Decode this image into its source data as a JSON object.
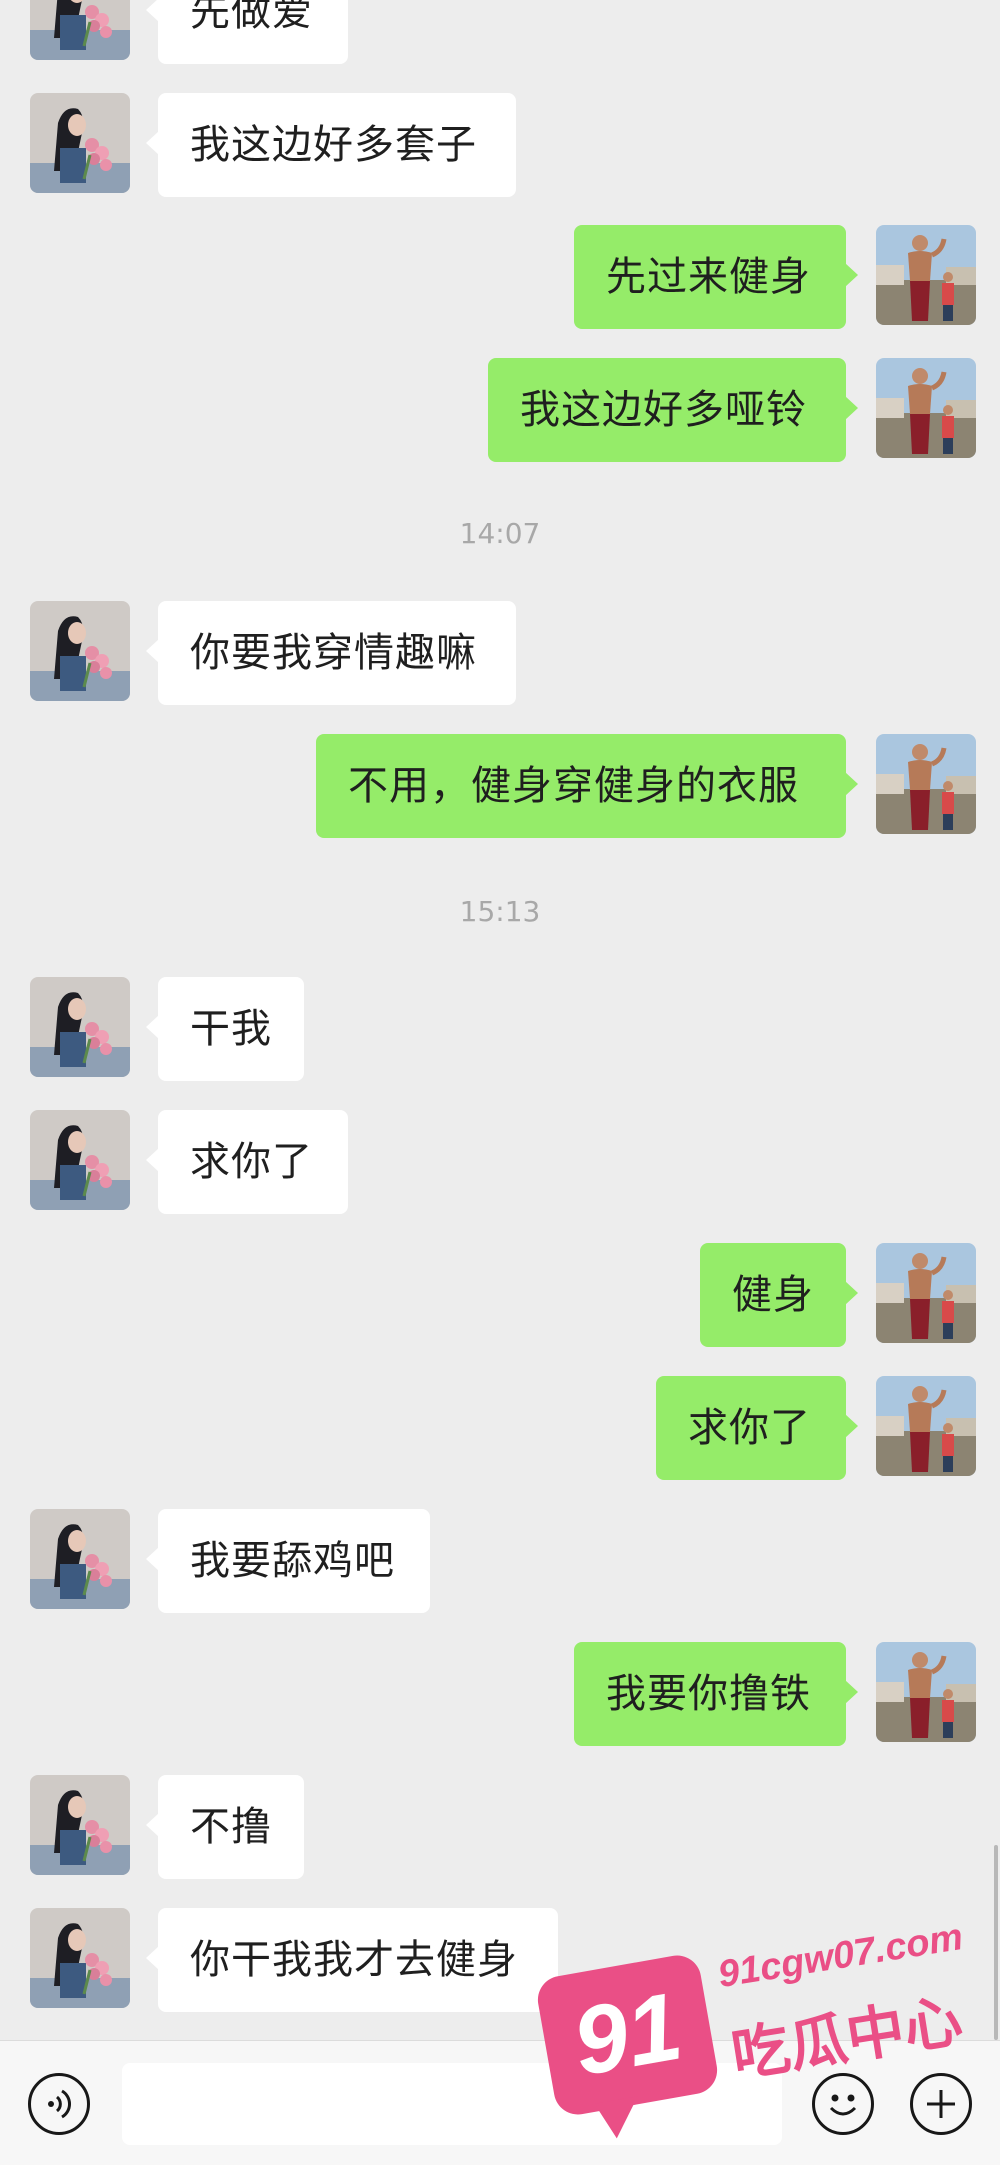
{
  "messages": [
    {
      "side": "in",
      "text": "先做爱"
    },
    {
      "side": "in",
      "text": "我这边好多套子"
    },
    {
      "side": "out",
      "text": "先过来健身"
    },
    {
      "side": "out",
      "text": "我这边好多哑铃"
    },
    {
      "side": "time",
      "text": "14:07"
    },
    {
      "side": "in",
      "text": "你要我穿情趣嘛"
    },
    {
      "side": "out",
      "text": "不用，健身穿健身的衣服"
    },
    {
      "side": "time",
      "text": "15:13"
    },
    {
      "side": "in",
      "text": "干我"
    },
    {
      "side": "in",
      "text": "求你了"
    },
    {
      "side": "out",
      "text": "健身"
    },
    {
      "side": "out",
      "text": "求你了"
    },
    {
      "side": "in",
      "text": "我要舔鸡吧"
    },
    {
      "side": "out",
      "text": "我要你撸铁"
    },
    {
      "side": "in",
      "text": "不撸"
    },
    {
      "side": "in",
      "text": "你干我我才去健身"
    }
  ],
  "input": {
    "value": "",
    "placeholder": ""
  },
  "icons": {
    "voice": "voice-icon",
    "emoji": "emoji-icon",
    "plus": "plus-icon"
  },
  "watermark": {
    "number": "91",
    "url": "91cgw07.com",
    "name": "吃瓜中心"
  },
  "colors": {
    "background": "#ededed",
    "incoming_bubble": "#ffffff",
    "outgoing_bubble": "#95ec69",
    "timestamp": "#a8a8a8",
    "watermark": "#ea4f86"
  }
}
